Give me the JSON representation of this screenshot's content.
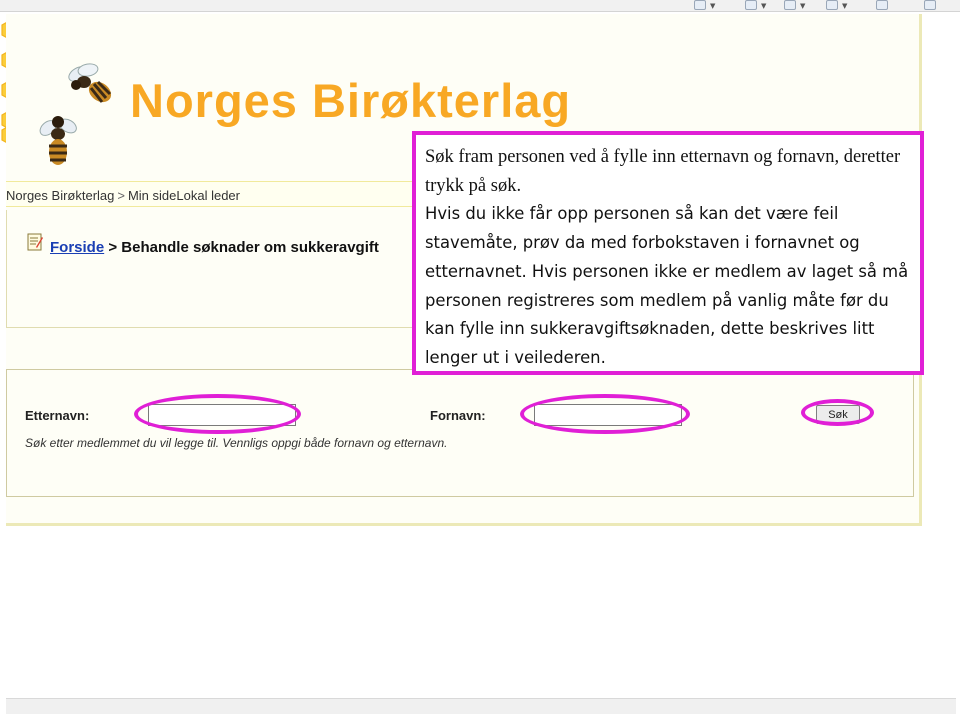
{
  "site": {
    "title": "Norges Birøkterlag"
  },
  "breadcrumb": {
    "items": [
      "Norges Birøkterlag",
      "Min side",
      "Lokal leder"
    ],
    "separator": ">"
  },
  "heading": {
    "home_link": "Forside",
    "separator": ">",
    "title": "Behandle søknader om sukkeravgift"
  },
  "search": {
    "lastname_label": "Etternavn:",
    "lastname_value": "",
    "firstname_label": "Fornavn:",
    "firstname_value": "",
    "button_label": "Søk",
    "hint": "Søk etter medlemmet du vil legge til. Vennligs oppgi både fornavn og etternavn."
  },
  "callout": {
    "paragraph1": "Søk fram personen ved å fylle inn etternavn og fornavn, deretter trykk på søk.",
    "paragraph2": "Hvis du ikke får opp personen så kan det være feil stavemåte, prøv da med forbokstaven i fornavnet og etternavnet. Hvis personen ikke er medlem av laget så må personen registreres som medlem på vanlig måte før du kan fylle inn sukkeravgiftsøknaden, dette beskrives litt lenger ut i veilederen."
  },
  "colors": {
    "title_orange": "#f8a824",
    "highlight_magenta": "#e01fd6",
    "link_blue": "#1a3fb4",
    "honeycomb": "#fbcd3a"
  },
  "icons": [
    "honeycomb-graphic",
    "bee-icon",
    "document-icon",
    "browser-toolbar-icon"
  ]
}
